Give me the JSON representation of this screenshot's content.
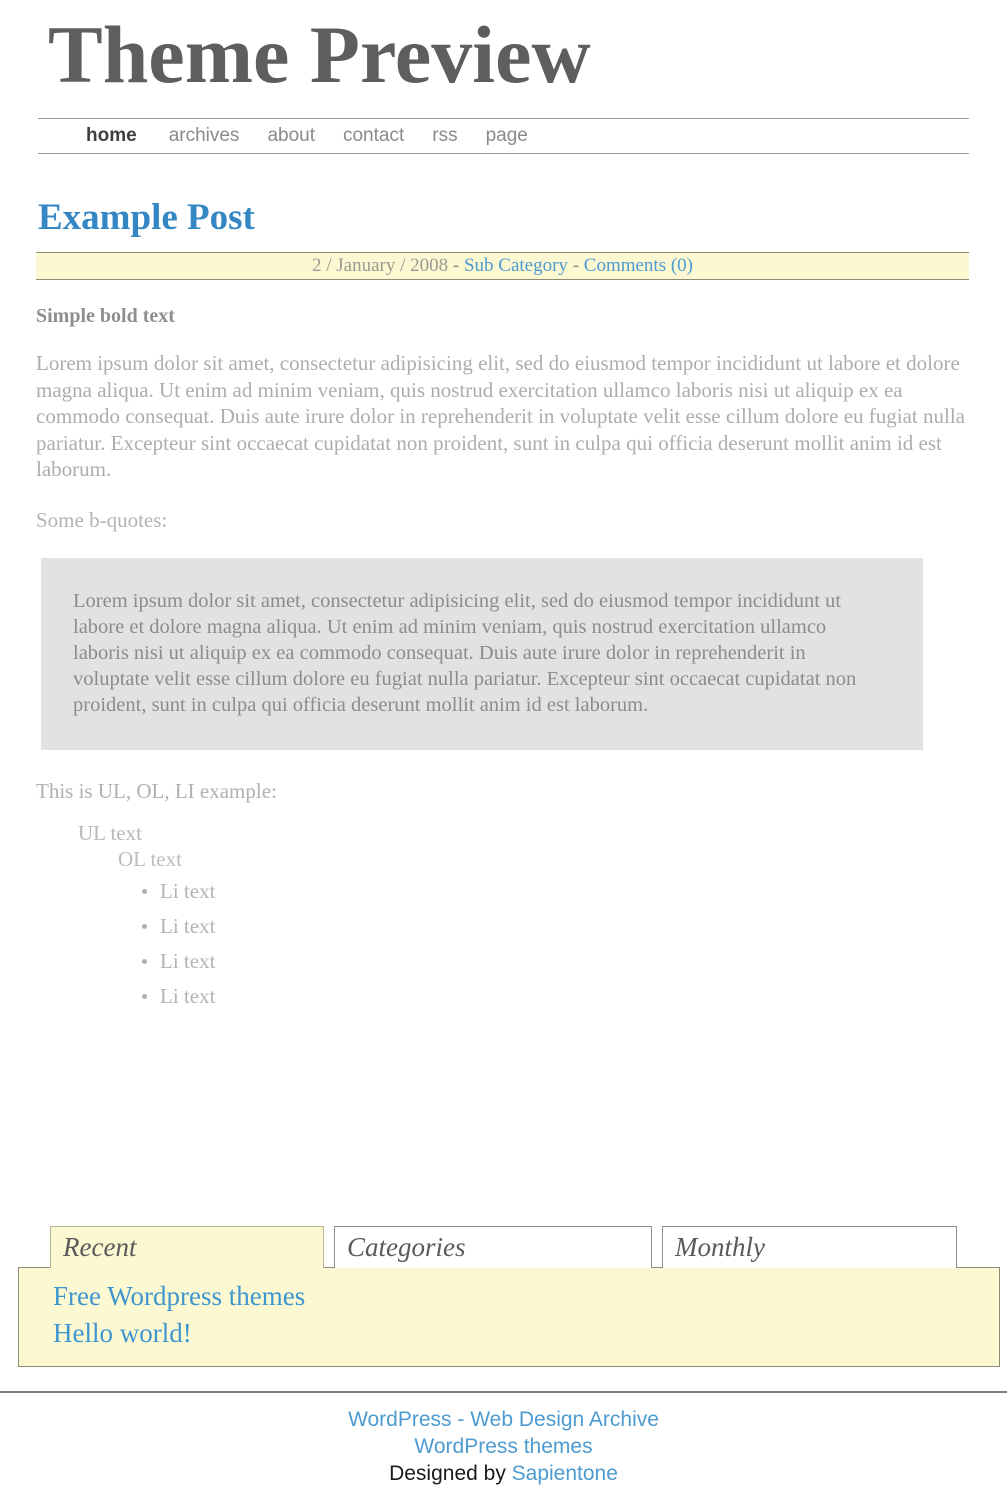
{
  "header": {
    "site_title": "Theme Preview"
  },
  "nav": {
    "items": [
      {
        "label": "home",
        "current": true
      },
      {
        "label": "archives",
        "current": false
      },
      {
        "label": "about",
        "current": false
      },
      {
        "label": "contact",
        "current": false
      },
      {
        "label": "rss",
        "current": false
      },
      {
        "label": "page",
        "current": false
      }
    ]
  },
  "post": {
    "title": "Example Post",
    "meta": {
      "day": "2",
      "sep1": " / ",
      "month": "January",
      "sep2": " / ",
      "year": "2008",
      "dash1": " - ",
      "category": "Sub Category",
      "dash2": " - ",
      "comments": "Comments (0)"
    },
    "bold_lead": "Simple bold text",
    "paragraph": "Lorem ipsum dolor sit amet, consectetur adipisicing elit, sed do eiusmod tempor incididunt ut labore et dolore magna aliqua. Ut enim ad minim veniam, quis nostrud exercitation ullamco laboris nisi ut aliquip ex ea commodo consequat. Duis aute irure dolor in reprehenderit in voluptate velit esse cillum dolore eu fugiat nulla pariatur. Excepteur sint occaecat cupidatat non proident, sunt in culpa qui officia deserunt mollit anim id est laborum.",
    "blockquote_lead": "Some b-quotes:",
    "blockquote": "Lorem ipsum dolor sit amet, consectetur adipisicing elit, sed do eiusmod tempor incididunt ut labore et dolore magna aliqua. Ut enim ad minim veniam, quis nostrud exercitation ullamco laboris nisi ut aliquip ex ea commodo consequat. Duis aute irure dolor in reprehenderit in voluptate velit esse cillum dolore eu fugiat nulla pariatur. Excepteur sint occaecat cupidatat non proident, sunt in culpa qui officia deserunt mollit anim id est laborum.",
    "list_lead": "This is UL, OL, LI example:",
    "ul_text": "UL text",
    "ol_text": "OL text",
    "li_items": [
      "Li text",
      "Li text",
      "Li text",
      "Li text"
    ]
  },
  "sidebar": {
    "tabs": [
      {
        "label": "Recent",
        "active": true
      },
      {
        "label": "Categories",
        "active": false
      },
      {
        "label": "Monthly",
        "active": false
      }
    ],
    "recent_items": [
      {
        "label": "Free Wordpress themes"
      },
      {
        "label": "Hello world!"
      }
    ]
  },
  "footer": {
    "line1_link1": "WordPress",
    "line1_dash": " - ",
    "line1_link2": "Web Design Archive",
    "line2_link": "WordPress themes",
    "line3_prefix": "Designed by ",
    "line3_link": "Sapientone"
  },
  "colors": {
    "link_blue": "#4d9bd0",
    "title_blue": "#3587c4",
    "header_gray": "#5e5e5e",
    "meta_yellow": "#fbf8d2",
    "blockquote_gray": "#e2e2e2",
    "body_gray": "#adadad"
  }
}
